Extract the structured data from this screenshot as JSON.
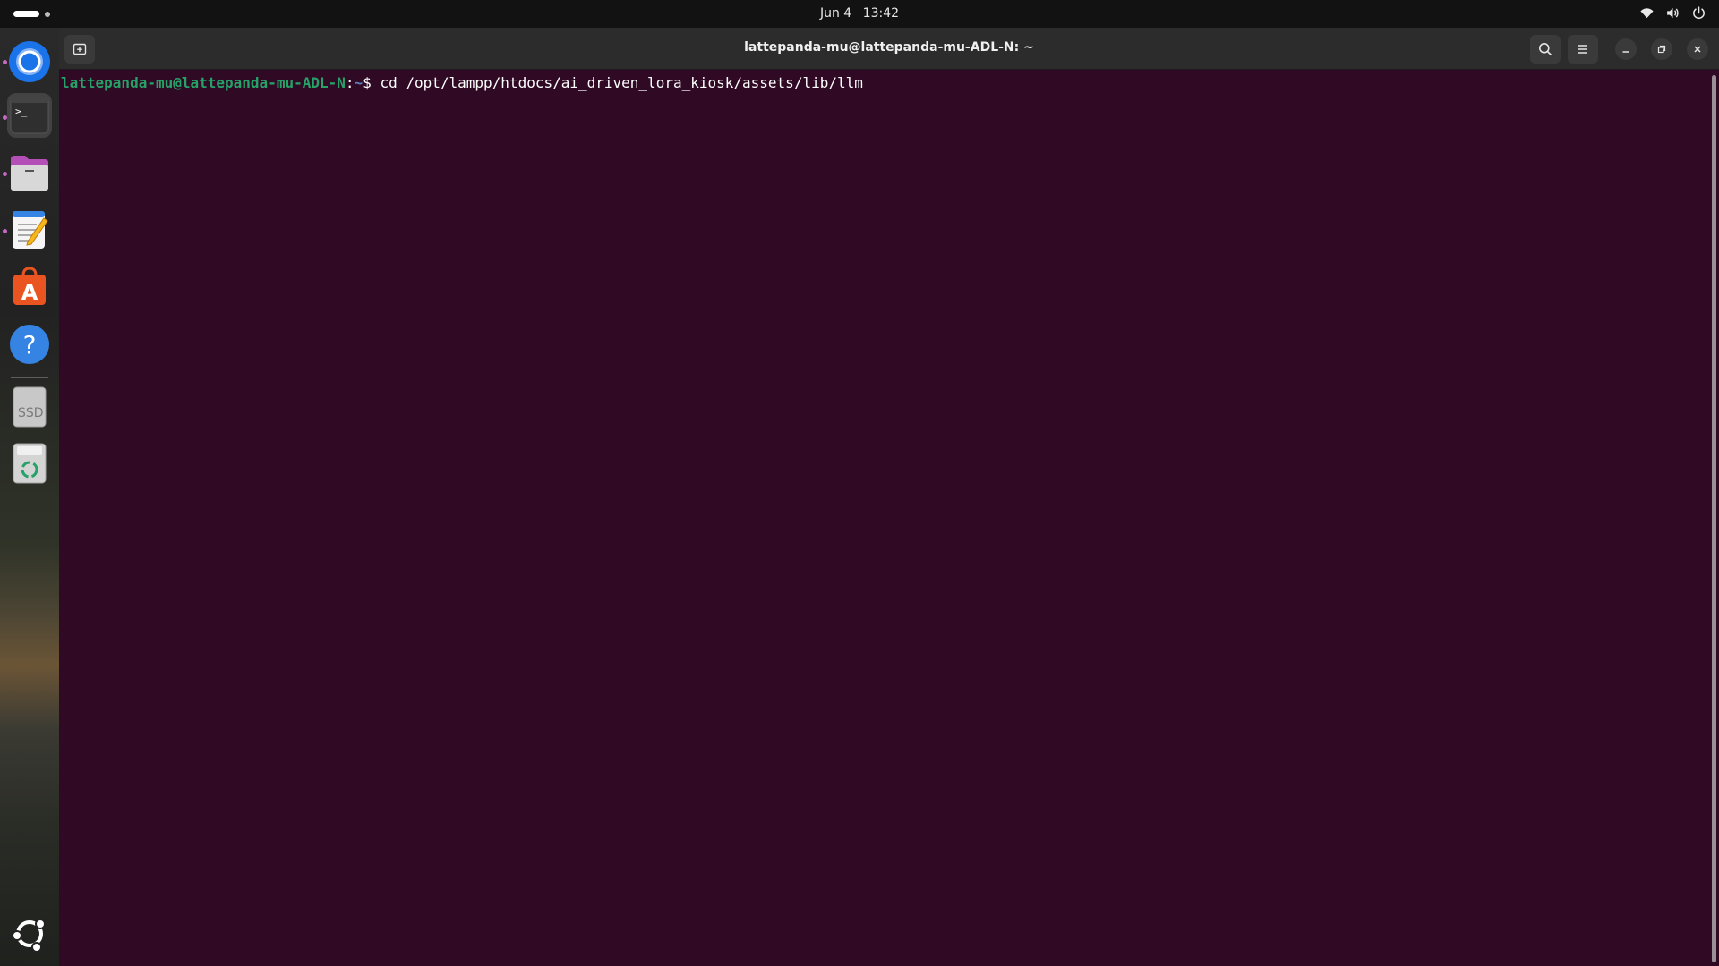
{
  "top_bar": {
    "date": "Jun 4",
    "time": "13:42",
    "tray_icons": [
      "wifi-icon",
      "volume-icon",
      "power-icon"
    ]
  },
  "dock": {
    "apps": [
      {
        "name": "Chromium",
        "icon": "chromium-icon",
        "running": true
      },
      {
        "name": "Terminal",
        "icon": "terminal-icon",
        "running": true,
        "active": true
      },
      {
        "name": "Files",
        "icon": "files-icon",
        "running": true
      },
      {
        "name": "Text Editor",
        "icon": "text-editor-icon",
        "running": true
      },
      {
        "name": "App Center",
        "icon": "app-center-icon"
      },
      {
        "name": "Help",
        "icon": "help-icon"
      },
      {
        "name": "SSD",
        "icon": "ssd-drive-icon",
        "label": "SSD"
      },
      {
        "name": "Trash",
        "icon": "trash-icon"
      },
      {
        "name": "Show Apps",
        "icon": "ubuntu-logo-icon"
      }
    ]
  },
  "terminal": {
    "title": "lattepanda-mu@lattepanda-mu-ADL-N: ~",
    "prompt_user": "lattepanda-mu@lattepanda-mu-ADL-N",
    "prompt_colon": ":",
    "prompt_path": "~",
    "prompt_symbol": "$ ",
    "command": "cd /opt/lampp/htdocs/ai_driven_lora_kiosk/assets/lib/llm"
  },
  "colors": {
    "terminal_bg": "#300a24",
    "prompt_user": "#26a269",
    "prompt_path": "#5e7fc2",
    "header_bg": "#2c2c2c",
    "top_bar_bg": "#121212"
  }
}
